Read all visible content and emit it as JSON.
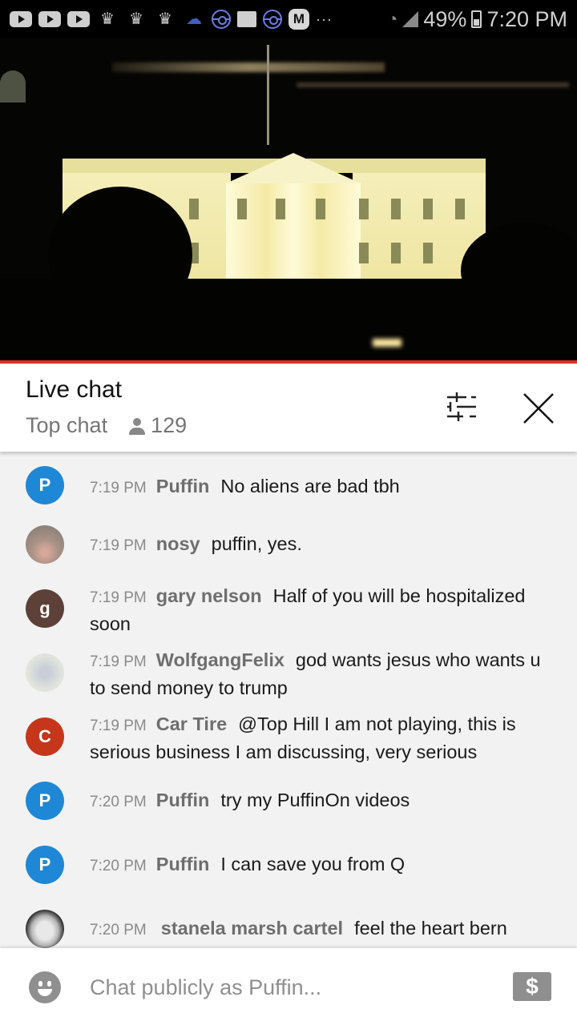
{
  "status_bar": {
    "notification_icons": [
      "youtube-icon",
      "youtube-icon",
      "youtube-icon",
      "crown-icon",
      "crown-icon",
      "crown-icon",
      "cloud-icon",
      "pokeball-icon",
      "folder-icon",
      "pokeball-icon",
      "m-app-icon",
      "more-icon"
    ],
    "more_glyph": "···",
    "m_label": "M",
    "crown_glyph": "♛",
    "cloud_glyph": "☁",
    "wifi_glyph": "◔",
    "battery": "49%",
    "time": "7:20 PM"
  },
  "video": {
    "description": "White House at night livestream",
    "progress_fraction": 1.0
  },
  "chat_header": {
    "title": "Live chat",
    "mode": "Top chat",
    "viewer_count": "129"
  },
  "messages": [
    {
      "time": "7:19 PM",
      "author": "Puffin",
      "text": "No aliens are bad tbh",
      "avatar_letter": "P",
      "avatar_color": "#1e88d6"
    },
    {
      "time": "7:19 PM",
      "author": "nosy",
      "text": "puffin, yes.",
      "avatar_letter": "",
      "avatar_color": "#b59d8c"
    },
    {
      "time": "7:19 PM",
      "author": "gary nelson",
      "text": "Half of you will be hospitalized soon",
      "avatar_letter": "g",
      "avatar_color": "#5d4037"
    },
    {
      "time": "7:19 PM",
      "author": "WolfgangFelix",
      "text": "god wants jesus who wants u to send money to trump",
      "avatar_letter": "",
      "avatar_color": "#d7dbd8"
    },
    {
      "time": "7:19 PM",
      "author": "Car Tire",
      "text": "@Top Hill I am not playing, this is serious business I am discussing, very serious",
      "avatar_letter": "C",
      "avatar_color": "#c5361b"
    },
    {
      "time": "7:20 PM",
      "author": "Puffin",
      "text": "try my PuffinOn videos",
      "avatar_letter": "P",
      "avatar_color": "#1e88d6"
    },
    {
      "time": "7:20 PM",
      "author": "Puffin",
      "text": "I can save you from Q",
      "avatar_letter": "P",
      "avatar_color": "#1e88d6"
    },
    {
      "time": "7:20 PM",
      "author": "stanela marsh cartel",
      "text": "feel the heart bern",
      "avatar_letter": "",
      "avatar_color": "#d0d0d0"
    }
  ],
  "input": {
    "placeholder": "Chat publicly as Puffin...",
    "superchat_glyph": "$"
  },
  "colors": {
    "accent_red": "#e52d27",
    "chat_bg": "#f2f2f2"
  }
}
